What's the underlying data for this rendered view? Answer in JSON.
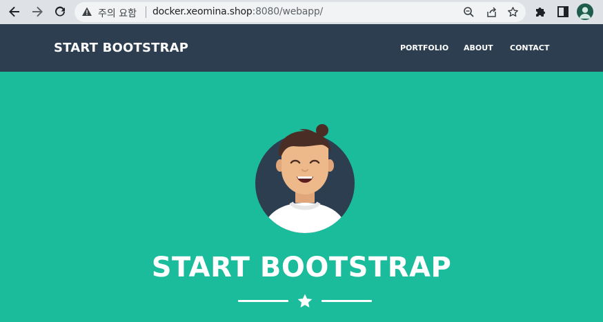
{
  "browser": {
    "security_label": "주의 요함",
    "url_host": "docker.xeomina.shop",
    "url_path": ":8080/webapp/",
    "icons": [
      "back-arrow-icon",
      "forward-arrow-icon",
      "reload-icon",
      "warning-icon",
      "zoom-icon",
      "share-icon",
      "star-icon",
      "puzzle-icon",
      "side-panel-icon",
      "profile-icon"
    ]
  },
  "navbar": {
    "brand": "START BOOTSTRAP",
    "links": [
      "PORTFOLIO",
      "ABOUT",
      "CONTACT"
    ],
    "bg_color": "#2c3e50"
  },
  "masthead": {
    "title": "START BOOTSTRAP",
    "bg_color": "#1abc9c",
    "divider_icon": "star-icon"
  }
}
